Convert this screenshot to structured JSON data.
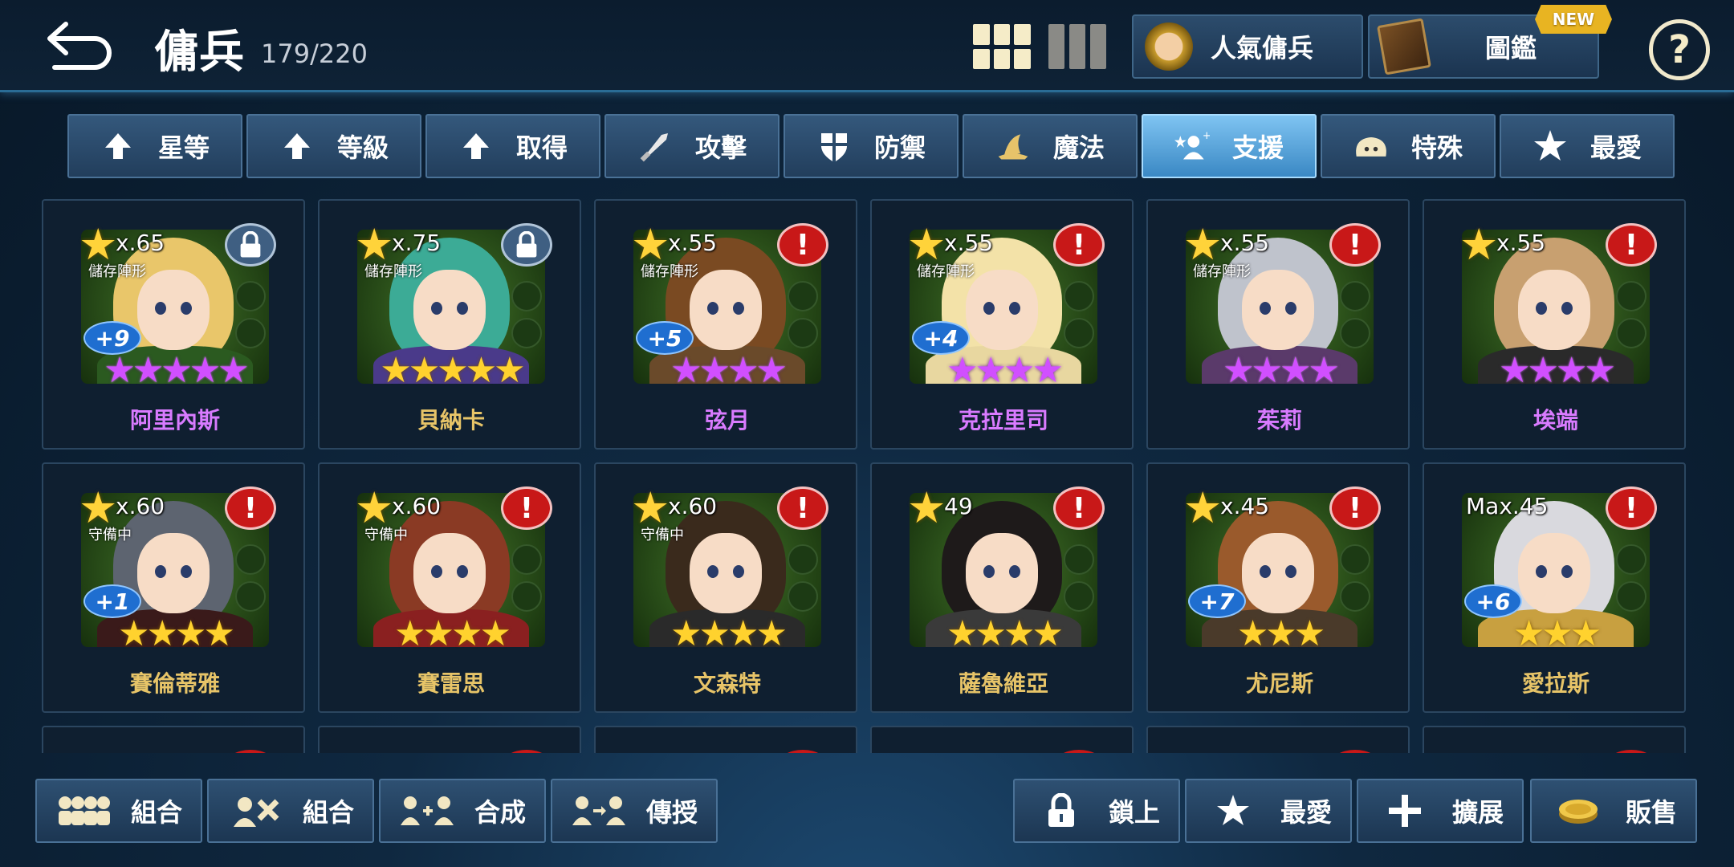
{
  "header": {
    "title": "傭兵",
    "count": "179/220",
    "popular_label": "人氣傭兵",
    "codex_label": "圖鑑",
    "new_badge": "NEW",
    "help": "?"
  },
  "tabs": [
    {
      "label": "星等",
      "icon": "arrow-up-icon"
    },
    {
      "label": "等級",
      "icon": "arrow-up-icon"
    },
    {
      "label": "取得",
      "icon": "arrow-up-icon"
    },
    {
      "label": "攻擊",
      "icon": "sword-icon"
    },
    {
      "label": "防禦",
      "icon": "shield-icon"
    },
    {
      "label": "魔法",
      "icon": "wizard-hat-icon"
    },
    {
      "label": "支援",
      "icon": "support-icon",
      "active": true
    },
    {
      "label": "特殊",
      "icon": "blob-icon"
    },
    {
      "label": "最愛",
      "icon": "star-icon"
    }
  ],
  "mercenaries": [
    {
      "name": "阿里內斯",
      "level": "x.65",
      "status": "儲存陣形",
      "plus": "+9",
      "stars": 5,
      "color": "purple",
      "badge": "lock"
    },
    {
      "name": "貝納卡",
      "level": "x.75",
      "status": "儲存陣形",
      "plus": "",
      "stars": 5,
      "color": "gold",
      "badge": "lock"
    },
    {
      "name": "弦月",
      "level": "x.55",
      "status": "儲存陣形",
      "plus": "+5",
      "stars": 4,
      "color": "purple",
      "badge": "alert"
    },
    {
      "name": "克拉里司",
      "level": "x.55",
      "status": "儲存陣形",
      "plus": "+4",
      "stars": 4,
      "color": "purple",
      "badge": "alert"
    },
    {
      "name": "茱莉",
      "level": "x.55",
      "status": "儲存陣形",
      "plus": "",
      "stars": 4,
      "color": "purple",
      "badge": "alert"
    },
    {
      "name": "埃端",
      "level": "x.55",
      "status": "",
      "plus": "",
      "stars": 4,
      "color": "purple",
      "badge": "alert"
    },
    {
      "name": "賽倫蒂雅",
      "level": "x.60",
      "status": "守備中",
      "plus": "+1",
      "stars": 4,
      "color": "gold",
      "badge": "alert"
    },
    {
      "name": "賽雷思",
      "level": "x.60",
      "status": "守備中",
      "plus": "",
      "stars": 4,
      "color": "gold",
      "badge": "alert"
    },
    {
      "name": "文森特",
      "level": "x.60",
      "status": "守備中",
      "plus": "",
      "stars": 4,
      "color": "gold",
      "badge": "alert"
    },
    {
      "name": "薩魯維亞",
      "level": "49",
      "status": "",
      "plus": "",
      "stars": 4,
      "color": "gold",
      "badge": "alert"
    },
    {
      "name": "尤尼斯",
      "level": "x.45",
      "status": "",
      "plus": "+7",
      "stars": 3,
      "color": "gold",
      "badge": "alert"
    },
    {
      "name": "愛拉斯",
      "level": "Max.45",
      "status": "",
      "plus": "+6",
      "stars": 3,
      "color": "gold",
      "badge": "alert"
    }
  ],
  "bottom_left": [
    {
      "label": "組合",
      "icon": "team-icon"
    },
    {
      "label": "組合",
      "icon": "combine-icon"
    },
    {
      "label": "合成",
      "icon": "fusion-icon"
    },
    {
      "label": "傳授",
      "icon": "transfer-icon"
    }
  ],
  "bottom_right": [
    {
      "label": "鎖上",
      "icon": "lock-icon"
    },
    {
      "label": "最愛",
      "icon": "star-icon"
    },
    {
      "label": "擴展",
      "icon": "plus-icon"
    },
    {
      "label": "販售",
      "icon": "gold-coin-icon"
    }
  ],
  "colors": {
    "accent": "#3a88c4",
    "alert": "#c81818",
    "star_purple": "#d14fff",
    "star_gold": "#ffd22e"
  }
}
